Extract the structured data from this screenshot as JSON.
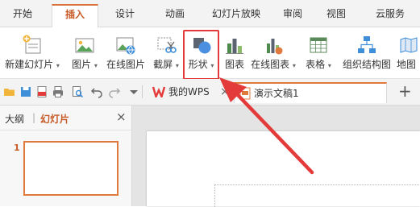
{
  "menu": {
    "tabs": [
      "开始",
      "插入",
      "设计",
      "动画",
      "幻灯片放映",
      "审阅",
      "视图",
      "云服务"
    ],
    "active": "插入"
  },
  "ribbon": {
    "new_slide": "新建幻灯片",
    "picture": "图片",
    "online_picture": "在线图片",
    "screenshot": "截屏",
    "shapes": "形状",
    "chart": "图表",
    "online_chart": "在线图表",
    "table": "表格",
    "org_chart": "组织结构图",
    "map": "地图",
    "caret": "▾"
  },
  "qat": {
    "tab_wps": "我的WPS",
    "tab_doc": "演示文稿1",
    "close_glyph": "×",
    "add_glyph": "+"
  },
  "pane": {
    "outline": "大纲",
    "separator": "|",
    "slides": "幻灯片",
    "close_glyph": "×",
    "slide_number": "1"
  },
  "colors": {
    "accent": "#d9713b",
    "highlight": "#e33a3a",
    "arrow": "#e33a3a"
  }
}
